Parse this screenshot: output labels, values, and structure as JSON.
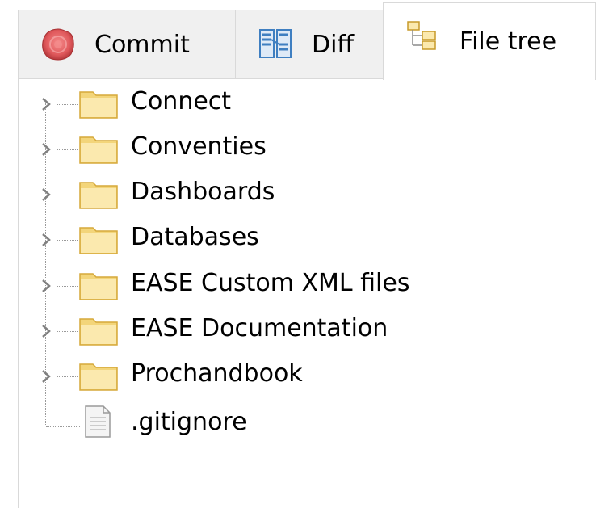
{
  "tabs": [
    {
      "label": "Commit",
      "icon": "commit-icon",
      "active": false
    },
    {
      "label": "Diff",
      "icon": "diff-icon",
      "active": false
    },
    {
      "label": "File tree",
      "icon": "file-tree-icon",
      "active": true
    }
  ],
  "tree": {
    "items": [
      {
        "label": "Connect",
        "type": "folder",
        "expandable": true
      },
      {
        "label": "Conventies",
        "type": "folder",
        "expandable": true
      },
      {
        "label": "Dashboards",
        "type": "folder",
        "expandable": true
      },
      {
        "label": "Databases",
        "type": "folder",
        "expandable": true
      },
      {
        "label": "EASE Custom XML files",
        "type": "folder",
        "expandable": true
      },
      {
        "label": "EASE Documentation",
        "type": "folder",
        "expandable": true
      },
      {
        "label": "Prochandbook",
        "type": "folder",
        "expandable": true
      },
      {
        "label": ".gitignore",
        "type": "file",
        "expandable": false
      }
    ]
  },
  "colors": {
    "folder": "#f3d57a",
    "folder_light": "#fbe9ae",
    "commit_red": "#e0595c",
    "diff_blue": "#3f7fc1",
    "tab_border": "#d9d9d9",
    "tab_inactive_bg": "#f0f0f0"
  }
}
